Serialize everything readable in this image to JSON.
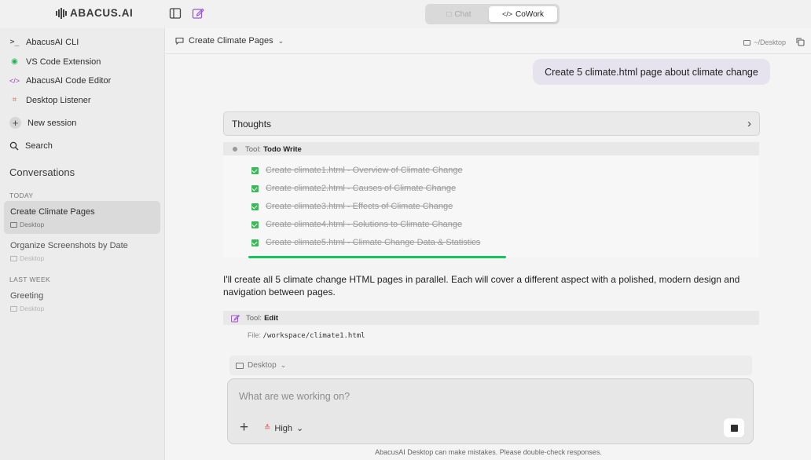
{
  "app": {
    "logo_text": "ABACUS.AI"
  },
  "mode_switch": {
    "chat_label": "Chat",
    "cowork_label": "CoWork",
    "active": "CoWork"
  },
  "sidebar": {
    "tools": [
      {
        "icon": "terminal-icon",
        "label": "AbacusAI CLI"
      },
      {
        "icon": "vscode-extension-icon",
        "label": "VS Code Extension"
      },
      {
        "icon": "code-editor-icon",
        "label": "AbacusAI Code Editor"
      },
      {
        "icon": "desktop-listener-icon",
        "label": "Desktop Listener"
      }
    ],
    "new_session": "New session",
    "search": "Search",
    "heading": "Conversations",
    "sections": [
      {
        "label": "TODAY"
      },
      {
        "label": "LAST WEEK"
      }
    ],
    "conversations": [
      {
        "title": "Create Climate Pages",
        "folder": "Desktop",
        "active": true
      },
      {
        "title": "Organize Screenshots by Date",
        "folder": "Desktop",
        "active": false
      },
      {
        "title": "Greeting",
        "folder": "Desktop",
        "active": false
      }
    ]
  },
  "header": {
    "title": "Create Climate Pages",
    "path": "~/Desktop"
  },
  "chat": {
    "user_message": "Create 5 climate.html page about climate change",
    "thoughts_label": "Thoughts",
    "todo_tool": {
      "prefix": "Tool:",
      "name": "Todo Write"
    },
    "todos": [
      "Create climate1.html - Overview of Climate Change",
      "Create climate2.html - Causes of Climate Change",
      "Create climate3.html - Effects of Climate Change",
      "Create climate4.html - Solutions to Climate Change",
      "Create climate5.html - Climate Change Data & Statistics"
    ],
    "todo_progress": 1.0,
    "assistant_text": "I'll create all 5 climate change HTML pages in parallel. Each will cover a different aspect with a polished, modern design and navigation between pages.",
    "edit_tool": {
      "prefix": "Tool:",
      "name": "Edit",
      "file_label": "File:",
      "file_path": "/workspace/climate1.html"
    }
  },
  "composer": {
    "directory": "Desktop",
    "placeholder": "What are we working on?",
    "effort": "High"
  },
  "disclaimer": "AbacusAI Desktop can make mistakes. Please double-check responses.",
  "colors": {
    "accent_green": "#18c45c",
    "user_bubble": "#e6e3ee",
    "edit_purple": "#9b59d0"
  }
}
